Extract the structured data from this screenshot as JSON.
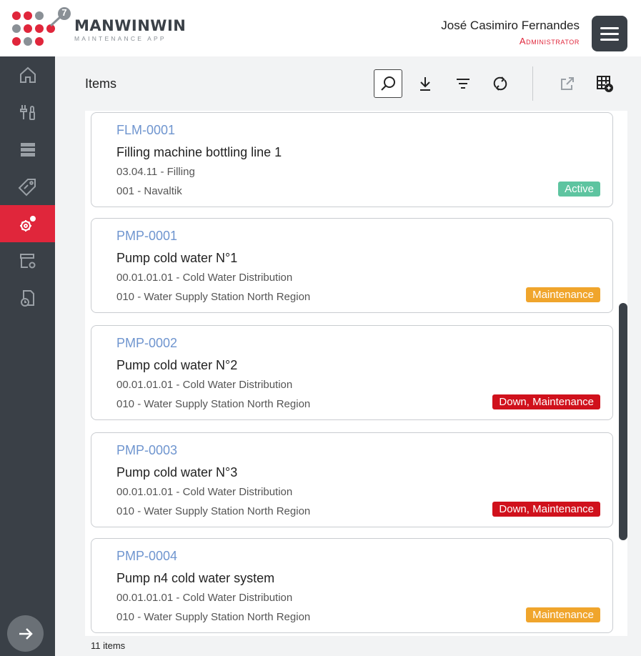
{
  "app": {
    "brand": "MANWINWIN",
    "tagline": "MAINTENANCE APP",
    "version_badge": "7"
  },
  "user": {
    "name": "José Casimiro Fernandes",
    "role": "Administrator"
  },
  "sidebar": {
    "items": [
      {
        "name": "home-icon",
        "active": false
      },
      {
        "name": "tools-icon",
        "active": false
      },
      {
        "name": "server-icon",
        "active": false
      },
      {
        "name": "tag-icon",
        "active": false
      },
      {
        "name": "gears-icon",
        "active": true
      },
      {
        "name": "store-settings-icon",
        "active": false
      },
      {
        "name": "document-clock-icon",
        "active": false
      }
    ]
  },
  "page": {
    "title": "Items",
    "count_label": "11 items"
  },
  "toolbar": {
    "tools": [
      "search-icon",
      "download-icon",
      "filter-icon",
      "refresh-icon",
      "external-link-icon",
      "table-add-icon"
    ]
  },
  "colors": {
    "accent": "#e0263b",
    "sidebar": "#3a4047",
    "link": "#6f95cf",
    "status_active": "#5ec4a0",
    "status_maintenance": "#f0a52c",
    "status_down": "#d0111c"
  },
  "items": [
    {
      "code": "FLM-0001",
      "name": "Filling machine bottling line 1",
      "path": "03.04.11 - Filling",
      "location": "001 - Navaltik",
      "status": "Active",
      "status_color": "#5ec4a0"
    },
    {
      "code": "PMP-0001",
      "name": "Pump cold water N°1",
      "path": "00.01.01.01 - Cold Water Distribution",
      "location": "010 - Water Supply Station North Region",
      "status": "Maintenance",
      "status_color": "#f0a52c"
    },
    {
      "code": "PMP-0002",
      "name": "Pump cold water N°2",
      "path": "00.01.01.01 - Cold Water Distribution",
      "location": "010 - Water Supply Station North Region",
      "status": "Down, Maintenance",
      "status_color": "#d0111c"
    },
    {
      "code": "PMP-0003",
      "name": "Pump cold water N°3",
      "path": "00.01.01.01 - Cold Water Distribution",
      "location": "010 - Water Supply Station North Region",
      "status": "Down, Maintenance",
      "status_color": "#d0111c"
    },
    {
      "code": "PMP-0004",
      "name": "Pump n4 cold water system",
      "path": "00.01.01.01 - Cold Water Distribution",
      "location": "010 - Water Supply Station North Region",
      "status": "Maintenance",
      "status_color": "#f0a52c"
    }
  ]
}
